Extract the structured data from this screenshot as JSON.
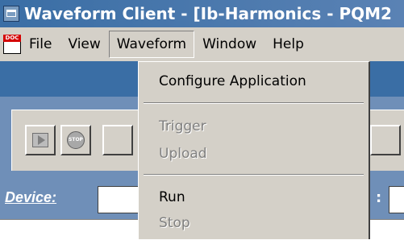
{
  "window": {
    "title": "Waveform Client - [Ib-Harmonics - PQM2"
  },
  "menubar": {
    "items": [
      {
        "label": "File"
      },
      {
        "label": "View"
      },
      {
        "label": "Waveform"
      },
      {
        "label": "Window"
      },
      {
        "label": "Help"
      }
    ],
    "active": "Waveform"
  },
  "app_icon_tag": "DOC",
  "dropdown": {
    "items": [
      {
        "label": "Configure Application",
        "enabled": true
      },
      {
        "label": "Trigger",
        "enabled": false
      },
      {
        "label": "Upload",
        "enabled": false
      },
      {
        "label": "Run",
        "enabled": true
      },
      {
        "label": "Stop",
        "enabled": false
      }
    ]
  },
  "toolbar": {
    "stop_icon_text": "STOP"
  },
  "device": {
    "label": "Device:",
    "value": "",
    "colon": ":"
  },
  "colors": {
    "title_bar": "#3a6ea5",
    "toolbar_bg": "#6f8fb8",
    "chrome": "#d4d0c8"
  }
}
